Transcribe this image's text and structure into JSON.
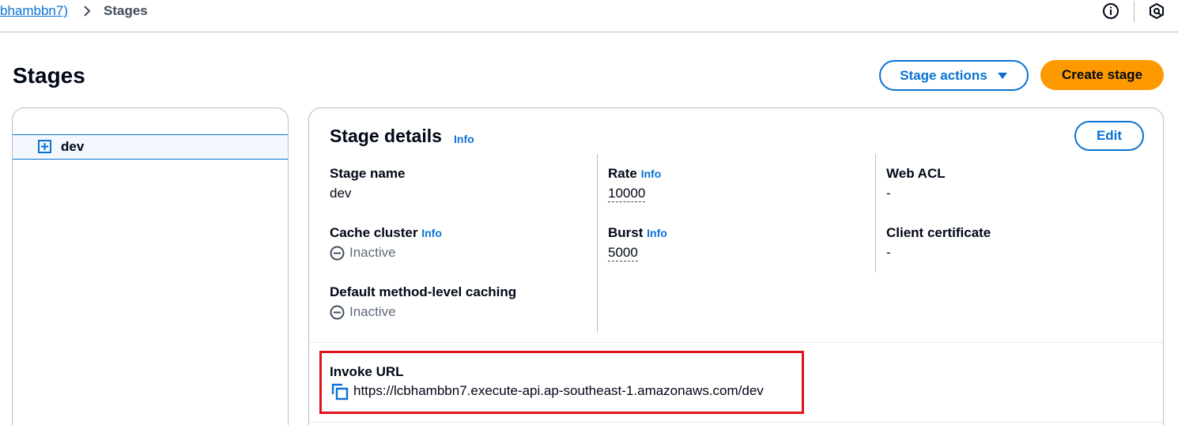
{
  "breadcrumb": {
    "parent_label": "bhambbn7)",
    "current_label": "Stages"
  },
  "icons": {
    "breadcrumb_separator": "chevron-right-icon",
    "info": "info-circle-icon",
    "settings": "settings-hexagon-icon",
    "expand": "plus-square-icon",
    "inactive": "minus-circle-icon",
    "copy": "copy-icon",
    "dropdown": "caret-down-icon"
  },
  "page": {
    "title": "Stages"
  },
  "actions": {
    "stage_actions_label": "Stage actions",
    "create_stage_label": "Create stage"
  },
  "tree": {
    "items": [
      {
        "label": "dev",
        "selected": true
      }
    ]
  },
  "details": {
    "title": "Stage details",
    "info_label": "Info",
    "edit_label": "Edit",
    "stage_name": {
      "label": "Stage name",
      "value": "dev"
    },
    "cache_cluster": {
      "label": "Cache cluster",
      "info": "Info",
      "value": "Inactive"
    },
    "default_caching": {
      "label": "Default method-level caching",
      "value": "Inactive"
    },
    "rate": {
      "label": "Rate",
      "info": "Info",
      "value": "10000"
    },
    "burst": {
      "label": "Burst",
      "info": "Info",
      "value": "5000"
    },
    "web_acl": {
      "label": "Web ACL",
      "value": "-"
    },
    "client_certificate": {
      "label": "Client certificate",
      "value": "-"
    },
    "invoke_url": {
      "label": "Invoke URL",
      "value": "https://lcbhambbn7.execute-api.ap-southeast-1.amazonaws.com/dev"
    }
  },
  "colors": {
    "link": "#0972d3",
    "primary_button": "#ff9900",
    "highlight": "#e0141e",
    "text": "#000716",
    "muted": "#5f6b7a"
  }
}
